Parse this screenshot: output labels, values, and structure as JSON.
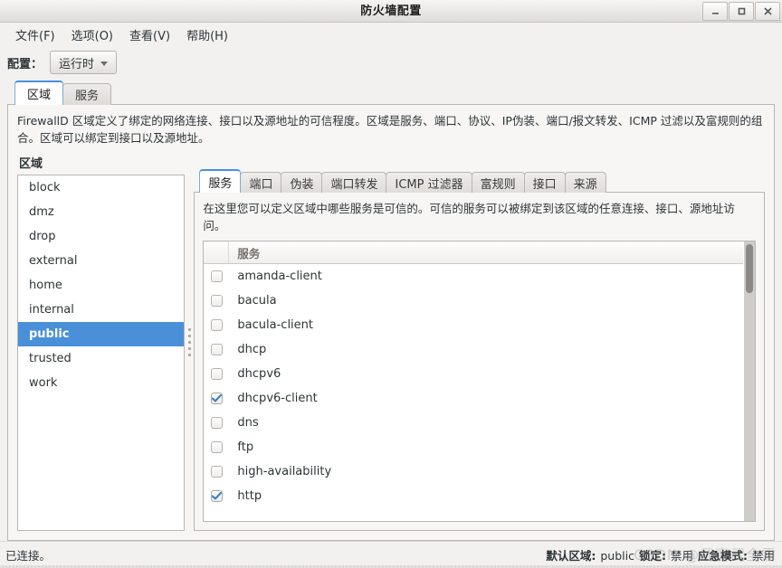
{
  "window": {
    "title": "防火墙配置",
    "buttons": [
      {
        "name": "minimize",
        "glyph": "_"
      },
      {
        "name": "maximize",
        "glyph": "□"
      },
      {
        "name": "close",
        "glyph": "✕"
      }
    ]
  },
  "menubar": {
    "items": [
      {
        "label": "文件(F)",
        "name": "menu-file"
      },
      {
        "label": "选项(O)",
        "name": "menu-options"
      },
      {
        "label": "查看(V)",
        "name": "menu-view"
      },
      {
        "label": "帮助(H)",
        "name": "menu-help"
      }
    ]
  },
  "config": {
    "label": "配置：",
    "selected": "运行时"
  },
  "main_tabs": [
    {
      "label": "区域",
      "active": true
    },
    {
      "label": "服务",
      "active": false
    }
  ],
  "zone_description": "FirewallD 区域定义了绑定的网络连接、接口以及源地址的可信程度。区域是服务、端口、协议、IP伪装、端口/报文转发、ICMP 过滤以及富规则的组合。区域可以绑定到接口以及源地址。",
  "zones": {
    "title": "区域",
    "items": [
      {
        "label": "block",
        "selected": false
      },
      {
        "label": "dmz",
        "selected": false
      },
      {
        "label": "drop",
        "selected": false
      },
      {
        "label": "external",
        "selected": false
      },
      {
        "label": "home",
        "selected": false
      },
      {
        "label": "internal",
        "selected": false
      },
      {
        "label": "public",
        "selected": true
      },
      {
        "label": "trusted",
        "selected": false
      },
      {
        "label": "work",
        "selected": false
      }
    ]
  },
  "zone_tabs": [
    {
      "label": "服务",
      "active": true
    },
    {
      "label": "端口",
      "active": false
    },
    {
      "label": "伪装",
      "active": false
    },
    {
      "label": "端口转发",
      "active": false
    },
    {
      "label": "ICMP 过滤器",
      "active": false
    },
    {
      "label": "富规则",
      "active": false
    },
    {
      "label": "接口",
      "active": false
    },
    {
      "label": "来源",
      "active": false
    }
  ],
  "services_description": "在这里您可以定义区域中哪些服务是可信的。可信的服务可以被绑定到该区域的任意连接、接口、源地址访问。",
  "services_table": {
    "column_header": "服务",
    "rows": [
      {
        "name": "amanda-client",
        "checked": false
      },
      {
        "name": "bacula",
        "checked": false
      },
      {
        "name": "bacula-client",
        "checked": false
      },
      {
        "name": "dhcp",
        "checked": false
      },
      {
        "name": "dhcpv6",
        "checked": false
      },
      {
        "name": "dhcpv6-client",
        "checked": true
      },
      {
        "name": "dns",
        "checked": false
      },
      {
        "name": "ftp",
        "checked": false
      },
      {
        "name": "high-availability",
        "checked": false
      },
      {
        "name": "http",
        "checked": true
      }
    ]
  },
  "statusbar": {
    "connection": "已连接。",
    "default_zone_label": "默认区域:",
    "default_zone_value": "public",
    "lockdown_label": "锁定:",
    "lockdown_value": "禁用",
    "panic_label": "应急模式:",
    "panic_value": "禁用"
  },
  "watermark": "CSDN @武喜武全需",
  "colors": {
    "selection": "#4a90d9",
    "window_bg": "#f2f1f0",
    "list_bg": "#ffffff",
    "border": "#b9b6b2"
  }
}
